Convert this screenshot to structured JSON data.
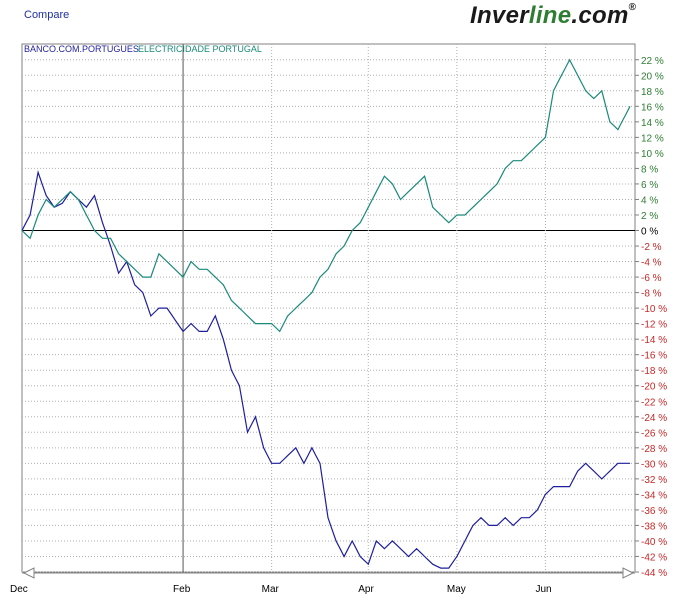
{
  "header": {
    "compare_label": "Compare",
    "brand_prefix": "Inver",
    "brand_accent": "line",
    "brand_suffix": ".com",
    "brand_reg": "®"
  },
  "chart_data": {
    "type": "line",
    "ylim": [
      -44,
      23
    ],
    "yticks": [
      22,
      20,
      18,
      16,
      14,
      12,
      10,
      8,
      6,
      4,
      2,
      0,
      -2,
      -4,
      -6,
      -8,
      -10,
      -12,
      -14,
      -16,
      -18,
      -20,
      -22,
      -24,
      -26,
      -28,
      -30,
      -32,
      -34,
      -36,
      -38,
      -40,
      -42,
      -44
    ],
    "ytick_suffix": " %",
    "positive_color": "#2e7d32",
    "zero_color": "#000000",
    "negative_color": "#c62828",
    "x_labels": [
      "Dec",
      "Feb",
      "Mar",
      "Apr",
      "May",
      "Jun"
    ],
    "x_label_index": [
      0,
      40,
      62,
      86,
      108,
      130
    ],
    "x_grid_index": [
      40,
      62,
      86,
      108,
      130
    ],
    "highlight_index": 40,
    "n_points": 152,
    "series": [
      {
        "name": "BANCO.COM.PORTUGUES",
        "color": "#1f1f9e",
        "keypoints": [
          [
            0,
            0
          ],
          [
            2,
            2
          ],
          [
            4,
            7.5
          ],
          [
            6,
            4.5
          ],
          [
            8,
            3
          ],
          [
            10,
            3.5
          ],
          [
            12,
            5
          ],
          [
            14,
            4
          ],
          [
            16,
            3
          ],
          [
            18,
            4.5
          ],
          [
            20,
            1
          ],
          [
            22,
            -2
          ],
          [
            24,
            -5.5
          ],
          [
            26,
            -4
          ],
          [
            28,
            -7
          ],
          [
            30,
            -8
          ],
          [
            32,
            -11
          ],
          [
            34,
            -10
          ],
          [
            36,
            -10
          ],
          [
            38,
            -11.5
          ],
          [
            40,
            -13
          ],
          [
            42,
            -12
          ],
          [
            44,
            -13
          ],
          [
            46,
            -13
          ],
          [
            48,
            -11
          ],
          [
            50,
            -14
          ],
          [
            52,
            -18
          ],
          [
            54,
            -20
          ],
          [
            56,
            -26
          ],
          [
            58,
            -24
          ],
          [
            60,
            -28
          ],
          [
            62,
            -30
          ],
          [
            64,
            -30
          ],
          [
            66,
            -29
          ],
          [
            68,
            -28
          ],
          [
            70,
            -30
          ],
          [
            72,
            -28
          ],
          [
            74,
            -30
          ],
          [
            76,
            -37
          ],
          [
            78,
            -40
          ],
          [
            80,
            -42
          ],
          [
            82,
            -40
          ],
          [
            84,
            -42
          ],
          [
            86,
            -43
          ],
          [
            88,
            -40
          ],
          [
            90,
            -41
          ],
          [
            92,
            -40
          ],
          [
            94,
            -41
          ],
          [
            96,
            -42
          ],
          [
            98,
            -41
          ],
          [
            100,
            -42
          ],
          [
            102,
            -43
          ],
          [
            104,
            -43.5
          ],
          [
            106,
            -43.5
          ],
          [
            108,
            -42
          ],
          [
            110,
            -40
          ],
          [
            112,
            -38
          ],
          [
            114,
            -37
          ],
          [
            116,
            -38
          ],
          [
            118,
            -38
          ],
          [
            120,
            -37
          ],
          [
            122,
            -38
          ],
          [
            124,
            -37
          ],
          [
            126,
            -37
          ],
          [
            128,
            -36
          ],
          [
            130,
            -34
          ],
          [
            132,
            -33
          ],
          [
            134,
            -33
          ],
          [
            136,
            -33
          ],
          [
            138,
            -31
          ],
          [
            140,
            -30
          ],
          [
            142,
            -31
          ],
          [
            144,
            -32
          ],
          [
            146,
            -31
          ],
          [
            148,
            -30
          ],
          [
            150,
            -30
          ],
          [
            151,
            -30
          ]
        ]
      },
      {
        "name": "ELECTRICIDADE PORTUGAL",
        "color": "#1a8a7a",
        "keypoints": [
          [
            0,
            0
          ],
          [
            2,
            -1
          ],
          [
            4,
            2
          ],
          [
            6,
            4
          ],
          [
            8,
            3
          ],
          [
            10,
            4
          ],
          [
            12,
            5
          ],
          [
            14,
            4
          ],
          [
            16,
            2
          ],
          [
            18,
            0
          ],
          [
            20,
            -1
          ],
          [
            22,
            -1
          ],
          [
            24,
            -3
          ],
          [
            26,
            -4
          ],
          [
            28,
            -5
          ],
          [
            30,
            -6
          ],
          [
            32,
            -6
          ],
          [
            34,
            -3
          ],
          [
            36,
            -4
          ],
          [
            38,
            -5
          ],
          [
            40,
            -6
          ],
          [
            42,
            -4
          ],
          [
            44,
            -5
          ],
          [
            46,
            -5
          ],
          [
            48,
            -6
          ],
          [
            50,
            -7
          ],
          [
            52,
            -9
          ],
          [
            54,
            -10
          ],
          [
            56,
            -11
          ],
          [
            58,
            -12
          ],
          [
            60,
            -12
          ],
          [
            62,
            -12
          ],
          [
            64,
            -13
          ],
          [
            66,
            -11
          ],
          [
            68,
            -10
          ],
          [
            70,
            -9
          ],
          [
            72,
            -8
          ],
          [
            74,
            -6
          ],
          [
            76,
            -5
          ],
          [
            78,
            -3
          ],
          [
            80,
            -2
          ],
          [
            82,
            0
          ],
          [
            84,
            1
          ],
          [
            86,
            3
          ],
          [
            88,
            5
          ],
          [
            90,
            7
          ],
          [
            92,
            6
          ],
          [
            94,
            4
          ],
          [
            96,
            5
          ],
          [
            98,
            6
          ],
          [
            100,
            7
          ],
          [
            102,
            3
          ],
          [
            104,
            2
          ],
          [
            106,
            1
          ],
          [
            108,
            2
          ],
          [
            110,
            2
          ],
          [
            112,
            3
          ],
          [
            114,
            4
          ],
          [
            116,
            5
          ],
          [
            118,
            6
          ],
          [
            120,
            8
          ],
          [
            122,
            9
          ],
          [
            124,
            9
          ],
          [
            126,
            10
          ],
          [
            128,
            11
          ],
          [
            130,
            12
          ],
          [
            132,
            18
          ],
          [
            134,
            20
          ],
          [
            136,
            22
          ],
          [
            138,
            20
          ],
          [
            140,
            18
          ],
          [
            142,
            17
          ],
          [
            144,
            18
          ],
          [
            146,
            14
          ],
          [
            148,
            13
          ],
          [
            150,
            15
          ],
          [
            151,
            16
          ]
        ]
      }
    ]
  }
}
